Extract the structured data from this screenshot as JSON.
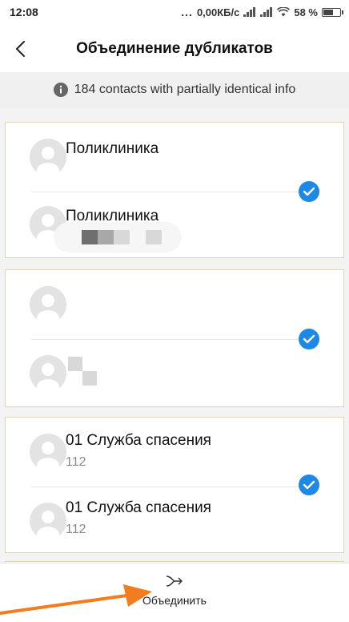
{
  "status_bar": {
    "time": "12:08",
    "network_speed": "0,00КБ/с",
    "battery_percent": "58 %",
    "battery_level": 0.58,
    "dots": "..."
  },
  "header": {
    "title": "Объединение дубликатов",
    "back_icon": "back-arrow-icon"
  },
  "info_banner": {
    "icon": "info-icon",
    "text": "184 contacts with partially identical info"
  },
  "groups": [
    {
      "selected": true,
      "contacts": [
        {
          "name": "Поликлиника",
          "phone": ""
        },
        {
          "name": "Поликлиника",
          "phone": ""
        }
      ]
    },
    {
      "selected": true,
      "contacts": [
        {
          "name": "",
          "phone": ""
        },
        {
          "name": "",
          "phone": ""
        }
      ]
    },
    {
      "selected": true,
      "contacts": [
        {
          "name": "01 Служба спасения",
          "phone": "112"
        },
        {
          "name": "01 Служба спасения",
          "phone": "112"
        }
      ]
    }
  ],
  "bottom_bar": {
    "merge_label": "Объединить",
    "merge_icon": "merge-arrows-icon"
  },
  "colors": {
    "accent": "#1e88e5",
    "annotation_arrow": "#f47c20",
    "group_border": "#e4d2b6"
  }
}
